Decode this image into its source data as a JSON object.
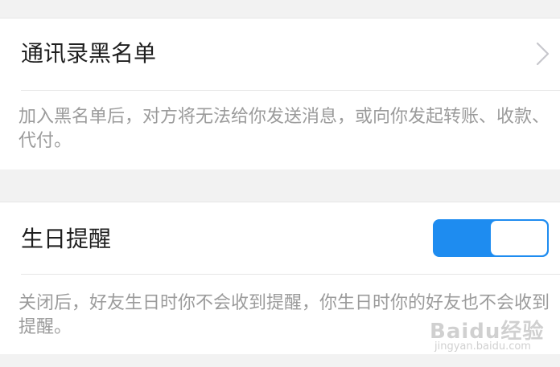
{
  "blacklist": {
    "title": "通讯录黑名单",
    "description": "加入黑名单后，对方将无法给你发送消息，或向你发起转账、收款、代付。",
    "chevron_icon": "chevron-right-icon"
  },
  "birthday": {
    "title": "生日提醒",
    "toggle_on": true,
    "toggle_color": "#1e8cf0",
    "description": "关闭后，好友生日时你不会收到提醒，你生日时你的好友也不会收到提醒。"
  },
  "watermark": {
    "main": "Baidu经验",
    "sub": "jingyan.baidu.com"
  }
}
